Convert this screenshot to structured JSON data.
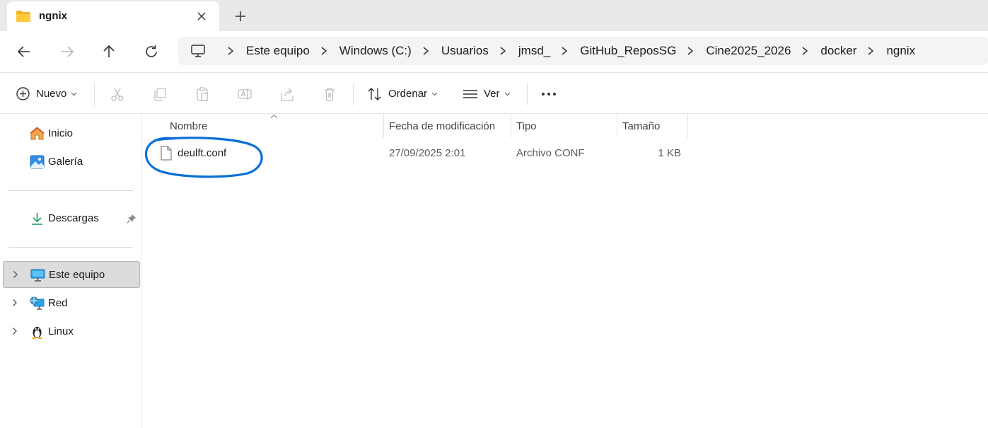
{
  "window": {
    "tab_title": "ngnix",
    "tab_icon": "folder-icon"
  },
  "navigation": {
    "back_icon": "arrow-left-icon",
    "forward_icon": "arrow-right-icon",
    "up_icon": "arrow-up-icon",
    "refresh_icon": "refresh-icon"
  },
  "breadcrumb": {
    "root_icon": "computer-icon",
    "items": [
      "Este equipo",
      "Windows (C:)",
      "Usuarios",
      "jmsd_",
      "GitHub_ReposSG",
      "Cine2025_2026",
      "docker",
      "ngnix"
    ]
  },
  "toolbar": {
    "new_label": "Nuevo",
    "sort_label": "Ordenar",
    "view_label": "Ver",
    "icons": [
      "plus-circle-icon",
      "cut-icon",
      "copy-icon",
      "paste-icon",
      "rename-icon",
      "share-icon",
      "delete-icon",
      "sort-icon",
      "view-icon",
      "more-icon"
    ]
  },
  "sidebar": {
    "items": [
      {
        "label": "Inicio",
        "icon": "home-icon"
      },
      {
        "label": "Galería",
        "icon": "gallery-icon"
      },
      {
        "label": "Descargas",
        "icon": "download-icon",
        "pinned": true
      },
      {
        "label": "Este equipo",
        "icon": "computer-icon",
        "selected": true,
        "expandable": true
      },
      {
        "label": "Red",
        "icon": "network-icon",
        "expandable": true
      },
      {
        "label": "Linux",
        "icon": "linux-icon",
        "expandable": true
      }
    ]
  },
  "filelist": {
    "columns": [
      "Nombre",
      "Fecha de modificación",
      "Tipo",
      "Tamaño"
    ],
    "sorted_by": "Nombre",
    "rows": [
      {
        "name": "deulft.conf",
        "modified": "27/09/2025 2:01",
        "type": "Archivo CONF",
        "size": "1 KB",
        "icon": "file-icon",
        "annotated": true
      }
    ]
  },
  "colors": {
    "accent": "#0a64c8",
    "annotation": "#0a6fd6",
    "titlebar": "#e9e9e9",
    "selected_bg": "#dcdcdc"
  }
}
